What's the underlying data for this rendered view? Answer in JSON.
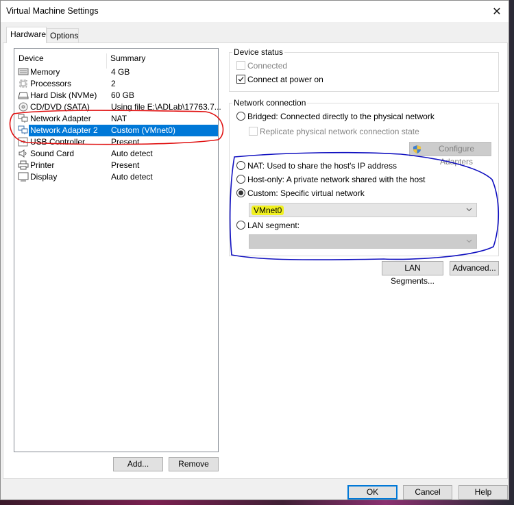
{
  "window": {
    "title": "Virtual Machine Settings",
    "close_icon": "close-icon"
  },
  "tabs": [
    {
      "label": "Hardware",
      "active": true
    },
    {
      "label": "Options",
      "active": false
    }
  ],
  "device_list": {
    "columns": [
      "Device",
      "Summary"
    ],
    "rows": [
      {
        "icon": "memory-icon",
        "name": "Memory",
        "summary": "4 GB",
        "selected": false
      },
      {
        "icon": "processor-icon",
        "name": "Processors",
        "summary": "2",
        "selected": false
      },
      {
        "icon": "hard-disk-icon",
        "name": "Hard Disk (NVMe)",
        "summary": "60 GB",
        "selected": false
      },
      {
        "icon": "cd-dvd-icon",
        "name": "CD/DVD (SATA)",
        "summary": "Using file E:\\ADLab\\17763.7...",
        "selected": false
      },
      {
        "icon": "network-adapter-icon",
        "name": "Network Adapter",
        "summary": "NAT",
        "selected": false
      },
      {
        "icon": "network-adapter-icon",
        "name": "Network Adapter 2",
        "summary": "Custom (VMnet0)",
        "selected": true
      },
      {
        "icon": "usb-controller-icon",
        "name": "USB Controller",
        "summary": "Present",
        "selected": false
      },
      {
        "icon": "sound-card-icon",
        "name": "Sound Card",
        "summary": "Auto detect",
        "selected": false
      },
      {
        "icon": "printer-icon",
        "name": "Printer",
        "summary": "Present",
        "selected": false
      },
      {
        "icon": "display-icon",
        "name": "Display",
        "summary": "Auto detect",
        "selected": false
      }
    ],
    "add_button": "Add...",
    "remove_button": "Remove"
  },
  "device_status": {
    "title": "Device status",
    "connected": {
      "label": "Connected",
      "checked": false,
      "enabled": false
    },
    "connect_at_power_on": {
      "label": "Connect at power on",
      "checked": true,
      "enabled": true
    }
  },
  "network_connection": {
    "title": "Network connection",
    "bridged": {
      "label": "Bridged: Connected directly to the physical network",
      "selected": false
    },
    "replicate": {
      "label": "Replicate physical network connection state",
      "checked": false,
      "enabled": false
    },
    "configure_adapters": "Configure Adapters",
    "nat": {
      "label": "NAT: Used to share the host's IP address",
      "selected": false
    },
    "host_only": {
      "label": "Host-only: A private network shared with the host",
      "selected": false
    },
    "custom": {
      "label": "Custom: Specific virtual network",
      "selected": true
    },
    "custom_network_value": "VMnet0",
    "lan_segment": {
      "label": "LAN segment:",
      "selected": false
    },
    "lan_segment_value": "",
    "lan_segments_button": "LAN Segments...",
    "advanced_button": "Advanced..."
  },
  "footer": {
    "ok": "OK",
    "cancel": "Cancel",
    "help": "Help"
  },
  "annotations": {
    "red_ellipse": "network adapters highlighted",
    "blue_outline": "network connection options highlighted",
    "yellow_highlight": "VMnet0",
    "colors": {
      "red": "#e01010",
      "blue": "#1010c0",
      "yellow": "#f0f020",
      "selection": "#0078d7"
    }
  }
}
